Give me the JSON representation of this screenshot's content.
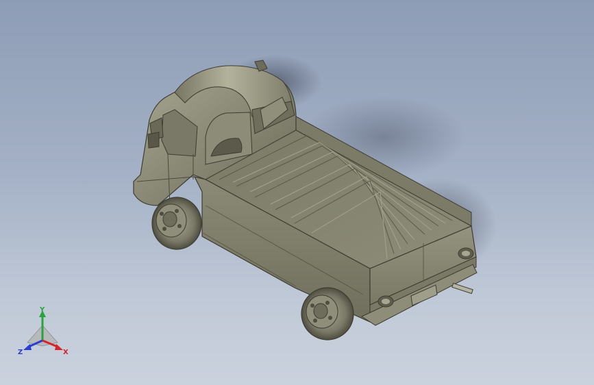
{
  "viewport": {
    "model_name": "",
    "background_top": "#8e9db6",
    "background_bottom": "#cbd2de"
  },
  "model": {
    "body_color": "#858471",
    "shade_color": "#5e5d4d",
    "highlight_color": "#b4b39f"
  },
  "triad": {
    "x_label": "X",
    "y_label": "Y",
    "z_label": "Z",
    "x_color": "#d7242a",
    "y_color": "#27a43a",
    "z_color": "#2a3fcf"
  }
}
